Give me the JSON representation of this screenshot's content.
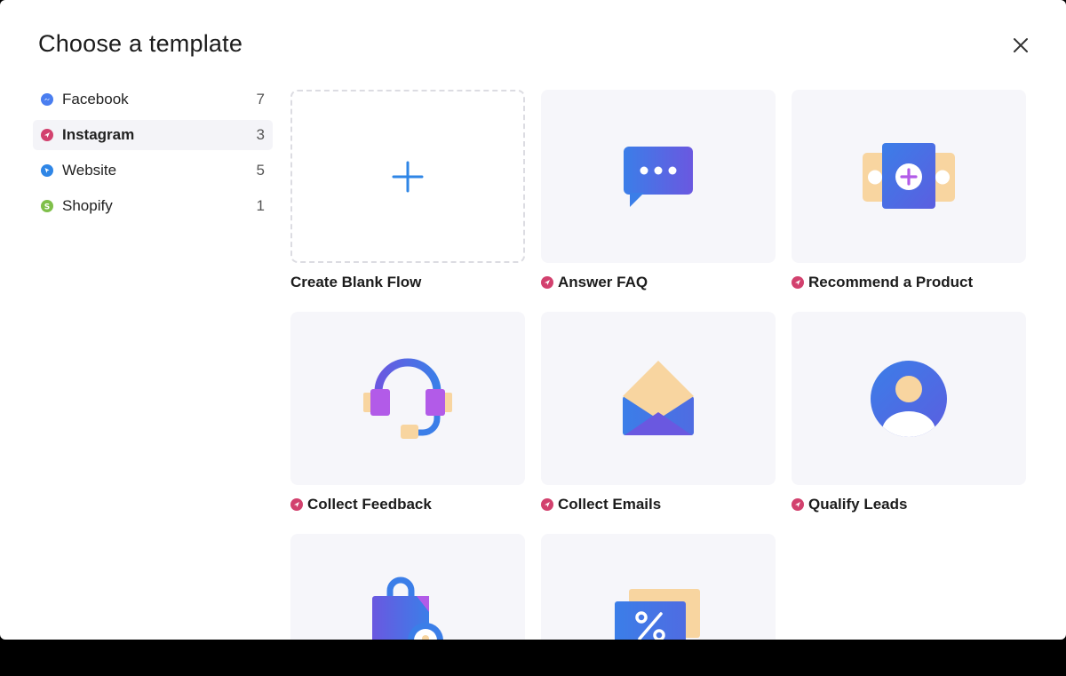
{
  "modal": {
    "title": "Choose a template",
    "close_icon": "close-icon"
  },
  "sidebar": {
    "items": [
      {
        "label": "Facebook",
        "count": "7",
        "icon": "messenger-icon",
        "color": "#4a7ef0"
      },
      {
        "label": "Instagram",
        "count": "3",
        "icon": "instagram-icon",
        "color": "#d2416e"
      },
      {
        "label": "Website",
        "count": "5",
        "icon": "cursor-icon",
        "color": "#2f86e6"
      },
      {
        "label": "Shopify",
        "count": "1",
        "icon": "shopify-icon",
        "color": "#7fbf4a"
      }
    ],
    "active": "Instagram"
  },
  "templates": [
    {
      "label": "Create Blank Flow",
      "icon": "plus-icon"
    },
    {
      "label": "Answer FAQ",
      "icon": "chat-bubble-icon"
    },
    {
      "label": "Recommend a Product",
      "icon": "product-card-icon"
    },
    {
      "label": "Collect Feedback",
      "icon": "headset-icon"
    },
    {
      "label": "Collect Emails",
      "icon": "envelope-icon"
    },
    {
      "label": "Qualify Leads",
      "icon": "user-avatar-icon"
    },
    {
      "label": "",
      "icon": "shopping-bag-icon"
    },
    {
      "label": "",
      "icon": "discount-coupon-icon"
    }
  ],
  "colors": {
    "accent": "#2f86e6",
    "instagram": "#d2416e",
    "thumb_bg": "#f6f6fa"
  }
}
